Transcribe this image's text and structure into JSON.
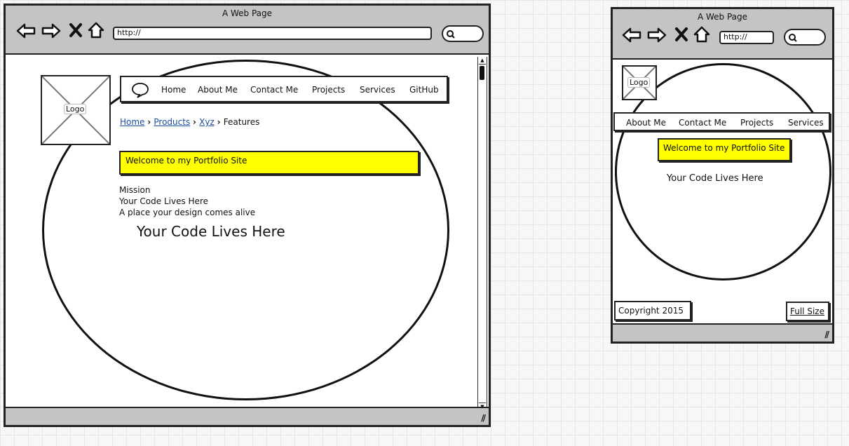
{
  "desktop": {
    "title": "A Web Page",
    "url": "http://",
    "logo": "Logo",
    "nav": [
      "Home",
      "About Me",
      "Contact Me",
      "Projects",
      "Services",
      "GitHub"
    ],
    "breadcrumb": [
      "Home",
      "Products",
      "Xyz",
      "Features"
    ],
    "welcome": "Welcome to my Portfolio Site",
    "mission": "Mission",
    "code_line": "Your Code Lives Here",
    "tagline": "A place your design comes alive",
    "heading": "Your Code Lives Here"
  },
  "mobile": {
    "title": "A Web Page",
    "url": "http://",
    "logo": "Logo",
    "nav": [
      "About Me",
      "Contact Me",
      "Projects",
      "Services"
    ],
    "welcome": "Welcome to my Portfolio Site",
    "code_line": "Your Code Lives Here",
    "copyright": "Copyright 2015",
    "full_size": "Full Size"
  },
  "colors": {
    "highlight": "#ffff00",
    "chrome": "#c4c4c4",
    "link": "#1a4c9c"
  }
}
